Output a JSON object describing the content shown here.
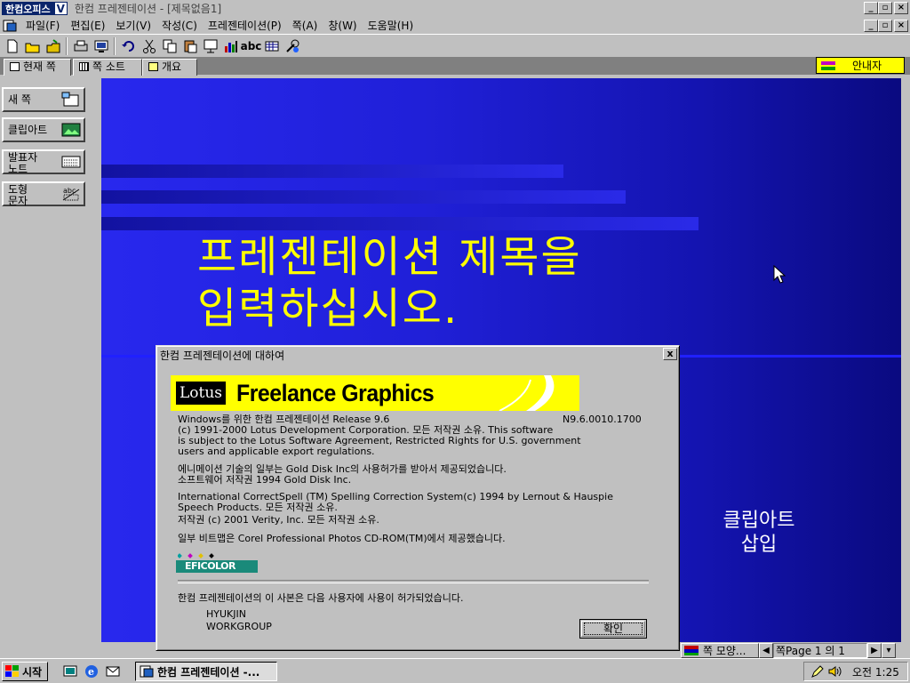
{
  "window": {
    "app_logo": "한컴오피스",
    "app_logo_suffix": "V",
    "title": "한컴 프레젠테이션 - [제목없음1]"
  },
  "menu": {
    "items": [
      "파일(F)",
      "편집(E)",
      "보기(V)",
      "작성(C)",
      "프레젠테이션(P)",
      "쪽(A)",
      "창(W)",
      "도움말(H)"
    ]
  },
  "toolbar": {
    "abc_label": "abc",
    "icons": [
      "new-document-icon",
      "open-folder-icon",
      "save-icon",
      "print-icon",
      "print-preview-icon",
      "undo-icon",
      "cut-icon",
      "copy-icon",
      "paste-icon",
      "slide-show-icon",
      "chart-icon",
      "spell-check-icon",
      "table-icon",
      "help-icon"
    ]
  },
  "tabs": [
    {
      "label": "현재 쪽",
      "active": true
    },
    {
      "label": "쪽 소트",
      "active": false
    },
    {
      "label": "개요",
      "active": false
    }
  ],
  "guide": {
    "label": "안내자"
  },
  "side_buttons": [
    {
      "line1": "새 쪽",
      "line2": ""
    },
    {
      "line1": "클립아트",
      "line2": ""
    },
    {
      "line1": "발표자",
      "line2": "노트"
    },
    {
      "line1": "도형",
      "line2": "문자"
    }
  ],
  "slide": {
    "title_line1": "프레젠테이션 제목을",
    "title_line2": "입력하십시오.",
    "clipart_line1": "클립아트",
    "clipart_line2": "삽입"
  },
  "about": {
    "title": "한컴 프레젠테이션에 대하여",
    "close": "x",
    "logo_lotus": "Lotus",
    "logo_product": "Freelance Graphics",
    "release": "Windows를 위한 한컴 프레젠테이션 Release 9.6",
    "release_code": "N9.6.0010.1700",
    "copyright_lines": [
      "(c) 1991-2000 Lotus Development Corporation.  모든 저작권 소유. This software",
      "is subject to the Lotus Software Agreement, Restricted Rights for U.S. government",
      "users and applicable export regulations."
    ],
    "animation_lines": [
      "에니메이션 기술의 일부는 Gold Disk Inc의 사용허가를 받아서 제공되었습니다.",
      "소프트웨어 저작권 1994 Gold Disk Inc."
    ],
    "spell_lines": [
      "International CorrectSpell (TM) Spelling Correction System(c) 1994 by Lernout & Hauspie",
      "Speech Products.  모든 저작권 소유.",
      "저작권 (c) 2001 Verity, Inc.  모든 저작권 소유."
    ],
    "bitmap_line": "일부 비트맵은 Corel Professional Photos CD-ROM(TM)에서 제공했습니다.",
    "efi_label": "EFICOLOR",
    "license_line": "한컴 프레젠테이션의 이 사본은 다음 사용자에 사용이 허가되었습니다.",
    "user_name": "HYUKJIN",
    "user_org": "WORKGROUP",
    "ok_label": "확인"
  },
  "status": {
    "layout_label": "쪽 모양...",
    "page_label": "쪽Page 1 의 1"
  },
  "taskbar": {
    "start_label": "시작",
    "task_label": "한컴 프레젠테이션 -...",
    "clock": "오전 1:25"
  }
}
